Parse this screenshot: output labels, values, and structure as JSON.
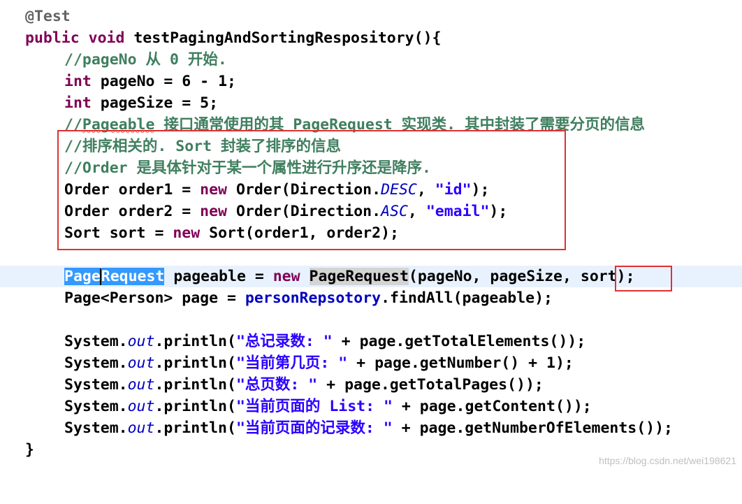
{
  "colors": {
    "keyword": "#7f0055",
    "annotation": "#646464",
    "comment": "#3f7f5f",
    "string": "#2a00ff",
    "field": "#0000c0",
    "highlight_box": "#e03030",
    "selection": "#3399ff",
    "current_line": "#e8f2fe"
  },
  "code": {
    "l1": {
      "annotation": "@Test"
    },
    "l2": {
      "kw1": "public",
      "kw2": "void",
      "rest": "testPagingAndSortingRespository(){"
    },
    "l3": {
      "comment": "//pageNo 从 0 开始."
    },
    "l4": {
      "kw": "int",
      "rest": "pageNo = 6 - 1;"
    },
    "l5": {
      "kw": "int",
      "rest": "pageSize = 5;"
    },
    "l6": {
      "comment_start": "//",
      "comment_squiggle": "Pageable",
      "comment_rest": " 接口通常使用的其 PageRequest 实现类. 其中封装了需要分页的信息"
    },
    "l7": {
      "comment": "//排序相关的. Sort 封装了排序的信息"
    },
    "l8": {
      "comment": "//Order 是具体针对于某一个属性进行升序还是降序."
    },
    "l9": {
      "a": "Order order1 = ",
      "kw": "new",
      "b": " Order(Direction.",
      "const": "DESC",
      "c": ", ",
      "str": "\"id\"",
      "d": ");"
    },
    "l10": {
      "a": "Order order2 = ",
      "kw": "new",
      "b": " Order(Direction.",
      "const": "ASC",
      "c": ", ",
      "str": "\"email\"",
      "d": ");"
    },
    "l11": {
      "a": "Sort sort = ",
      "kw": "new",
      "b": " Sort(order1, order2);"
    },
    "l13": {
      "sel1": "Page",
      "sel2": "Request",
      "a": " pageable = ",
      "kw": "new",
      "occ": "PageRequest",
      "b": "(pageNo, pageSize, ",
      "boxed": "sort",
      "c": ");"
    },
    "l14": {
      "a": "Page<Person> page = ",
      "field": "personRepsotory",
      "b": ".findAll(pageable);"
    },
    "l16": {
      "a": "System.",
      "out": "out",
      "b": ".println(",
      "str": "\"总记录数: \"",
      "c": " + page.getTotalElements());"
    },
    "l17": {
      "a": "System.",
      "out": "out",
      "b": ".println(",
      "str": "\"当前第几页: \"",
      "c": " + page.getNumber() + 1);"
    },
    "l18": {
      "a": "System.",
      "out": "out",
      "b": ".println(",
      "str": "\"总页数: \"",
      "c": " + page.getTotalPages());"
    },
    "l19": {
      "a": "System.",
      "out": "out",
      "b": ".println(",
      "str": "\"当前页面的 List: \"",
      "c": " + page.getContent());"
    },
    "l20": {
      "a": "System.",
      "out": "out",
      "b": ".println(",
      "str": "\"当前页面的记录数: \"",
      "c": " + page.getNumberOfElements());"
    },
    "l21": {
      "brace": "}"
    }
  },
  "watermark": "https://blog.csdn.net/wei198621"
}
